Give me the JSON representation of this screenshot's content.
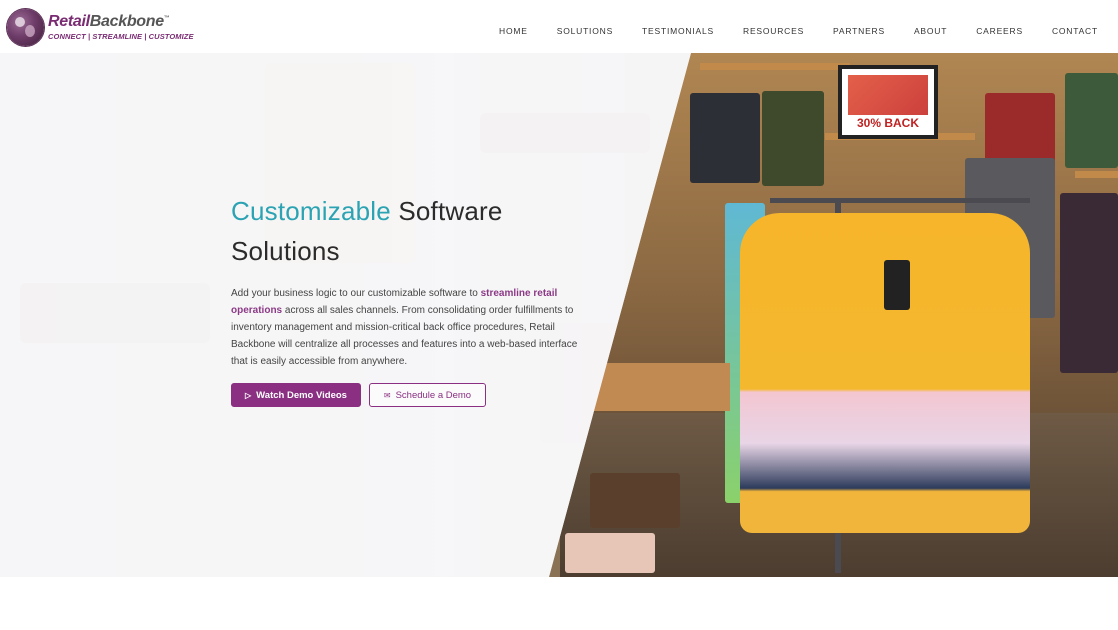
{
  "brand": {
    "name_part1": "Retail",
    "name_part2": "Backbone",
    "trademark": "™",
    "tagline": "CONNECT | STREAMLINE | CUSTOMIZE"
  },
  "nav": {
    "items": [
      {
        "label": "HOME"
      },
      {
        "label": "SOLUTIONS"
      },
      {
        "label": "TESTIMONIALS"
      },
      {
        "label": "RESOURCES"
      },
      {
        "label": "PARTNERS"
      },
      {
        "label": "ABOUT"
      },
      {
        "label": "CAREERS"
      },
      {
        "label": "CONTACT"
      }
    ]
  },
  "hero": {
    "headline_accent": "Customizable",
    "headline_rest": " Software Solutions",
    "desc_part1": "Add your business logic to our customizable software to ",
    "desc_highlight": "streamline retail operations",
    "desc_part2": " across all sales channels. From consolidating order fulfillments to inventory management and mission-critical back office procedures, Retail Backbone will centralize all processes and features into a web-based interface that is easily accessible from anywhere.",
    "sign_text": "30% BACK",
    "buttons": {
      "primary_icon": "▷",
      "primary_label": "Watch Demo Videos",
      "secondary_icon": "✉",
      "secondary_label": "Schedule a Demo"
    }
  },
  "colors": {
    "brand_purple": "#8a2f82",
    "accent_teal": "#2ba3b3"
  }
}
